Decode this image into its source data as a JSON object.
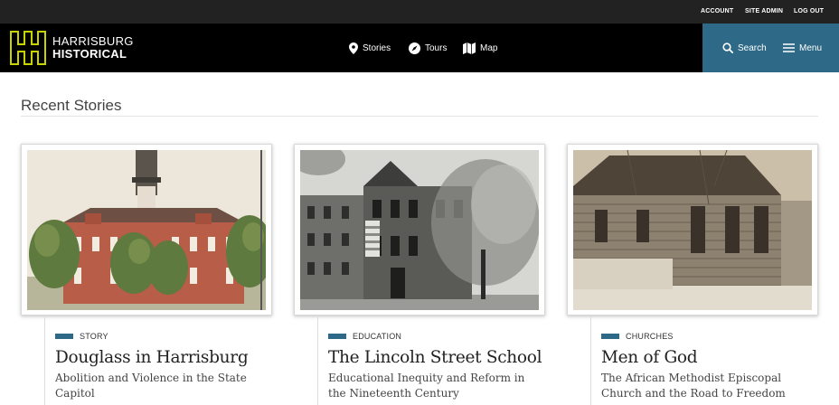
{
  "util_links": [
    "ACCOUNT",
    "SITE ADMIN",
    "LOG OUT"
  ],
  "logo": {
    "line1": "HARRISBURG",
    "line2": "HISTORICAL",
    "mark_color": "#c8d400"
  },
  "nav": [
    {
      "label": "Stories",
      "icon": "map-pin-icon"
    },
    {
      "label": "Tours",
      "icon": "compass-icon"
    },
    {
      "label": "Map",
      "icon": "folded-map-icon"
    }
  ],
  "header_right": {
    "search_label": "Search",
    "menu_label": "Menu"
  },
  "section": {
    "title": "Recent Stories"
  },
  "colors": {
    "accent": "#2e6a87",
    "header_bg": "#000000",
    "topbar_bg": "#222222"
  },
  "cards": [
    {
      "tag": "STORY",
      "title": "Douglass in Harrisburg",
      "subtitle": "Abolition and Violence in the State Capitol",
      "image": "illustration of a red brick building with a cupola tower and trees"
    },
    {
      "tag": "EDUCATION",
      "title": "The Lincoln Street School",
      "subtitle": "Educational Inequity and Reform in the Nineteenth Century",
      "image": "black and white photo of a brick school building with a flag and trees"
    },
    {
      "tag": "CHURCHES",
      "title": "Men of God",
      "subtitle": "The African Methodist Episcopal Church and the Road to Freedom",
      "image": "sepia photo of a wooden clapboard church building"
    }
  ]
}
